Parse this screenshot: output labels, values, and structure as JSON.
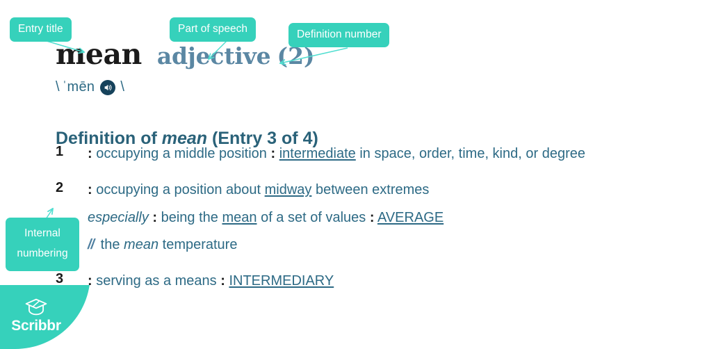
{
  "entry": {
    "headword": "mean",
    "part_of_speech": "adjective",
    "definition_number": "(2)",
    "pronunciation": {
      "open_slash": "\\",
      "text": "ˈmēn",
      "close_slash": "\\",
      "audio_icon": "speaker-icon"
    },
    "heading": {
      "prefix": "Definition of ",
      "word": "mean",
      "suffix": " (Entry 3 of 4)"
    },
    "senses": [
      {
        "number": "1",
        "lines": [
          {
            "type": "definition",
            "parts": [
              {
                "kind": "colon",
                "text": ":"
              },
              {
                "kind": "plain",
                "text": " occupying a middle position "
              },
              {
                "kind": "colon",
                "text": ":"
              },
              {
                "kind": "plain",
                "text": " "
              },
              {
                "kind": "xref",
                "text": "intermediate"
              },
              {
                "kind": "plain",
                "text": " in space, order, time, kind, or degree"
              }
            ]
          }
        ]
      },
      {
        "number": "2",
        "lines": [
          {
            "type": "definition",
            "parts": [
              {
                "kind": "colon",
                "text": ":"
              },
              {
                "kind": "plain",
                "text": " occupying a position about "
              },
              {
                "kind": "xref",
                "text": "midway"
              },
              {
                "kind": "plain",
                "text": " between extremes"
              }
            ]
          },
          {
            "type": "subsense",
            "parts": [
              {
                "kind": "italic",
                "text": "especially"
              },
              {
                "kind": "plain",
                "text": " "
              },
              {
                "kind": "colon",
                "text": ":"
              },
              {
                "kind": "plain",
                "text": " being the "
              },
              {
                "kind": "xref",
                "text": "mean"
              },
              {
                "kind": "plain",
                "text": " of a set of values "
              },
              {
                "kind": "colon",
                "text": ":"
              },
              {
                "kind": "plain",
                "text": " "
              },
              {
                "kind": "xref",
                "text": "AVERAGE"
              }
            ]
          },
          {
            "type": "example",
            "parts": [
              {
                "kind": "slashes",
                "text": "//"
              },
              {
                "kind": "plain",
                "text": " the "
              },
              {
                "kind": "italic",
                "text": "mean"
              },
              {
                "kind": "plain",
                "text": " temperature"
              }
            ]
          }
        ]
      },
      {
        "number": "3",
        "lines": [
          {
            "type": "definition",
            "parts": [
              {
                "kind": "colon",
                "text": ":"
              },
              {
                "kind": "plain",
                "text": " serving as a means "
              },
              {
                "kind": "colon",
                "text": ":"
              },
              {
                "kind": "plain",
                "text": " "
              },
              {
                "kind": "xref",
                "text": "INTERMEDIARY"
              }
            ]
          }
        ]
      }
    ]
  },
  "annotations": [
    {
      "id": "entry-title",
      "label": "Entry title"
    },
    {
      "id": "part-of-speech",
      "label": "Part of speech"
    },
    {
      "id": "def-number",
      "label": "Definition number"
    },
    {
      "id": "internal-num",
      "label_line1": "Internal",
      "label_line2": "numbering"
    }
  ],
  "branding": {
    "wordmark": "Scribbr",
    "logo_icon": "graduation-cap-icon"
  },
  "colors": {
    "accent_teal": "#36d1bb",
    "text_blue": "#2d6a85",
    "heading_blue": "#2a6279",
    "pos_blue": "#5b87a3",
    "headword_black": "#1b1b1b",
    "audio_navy": "#16425b"
  }
}
